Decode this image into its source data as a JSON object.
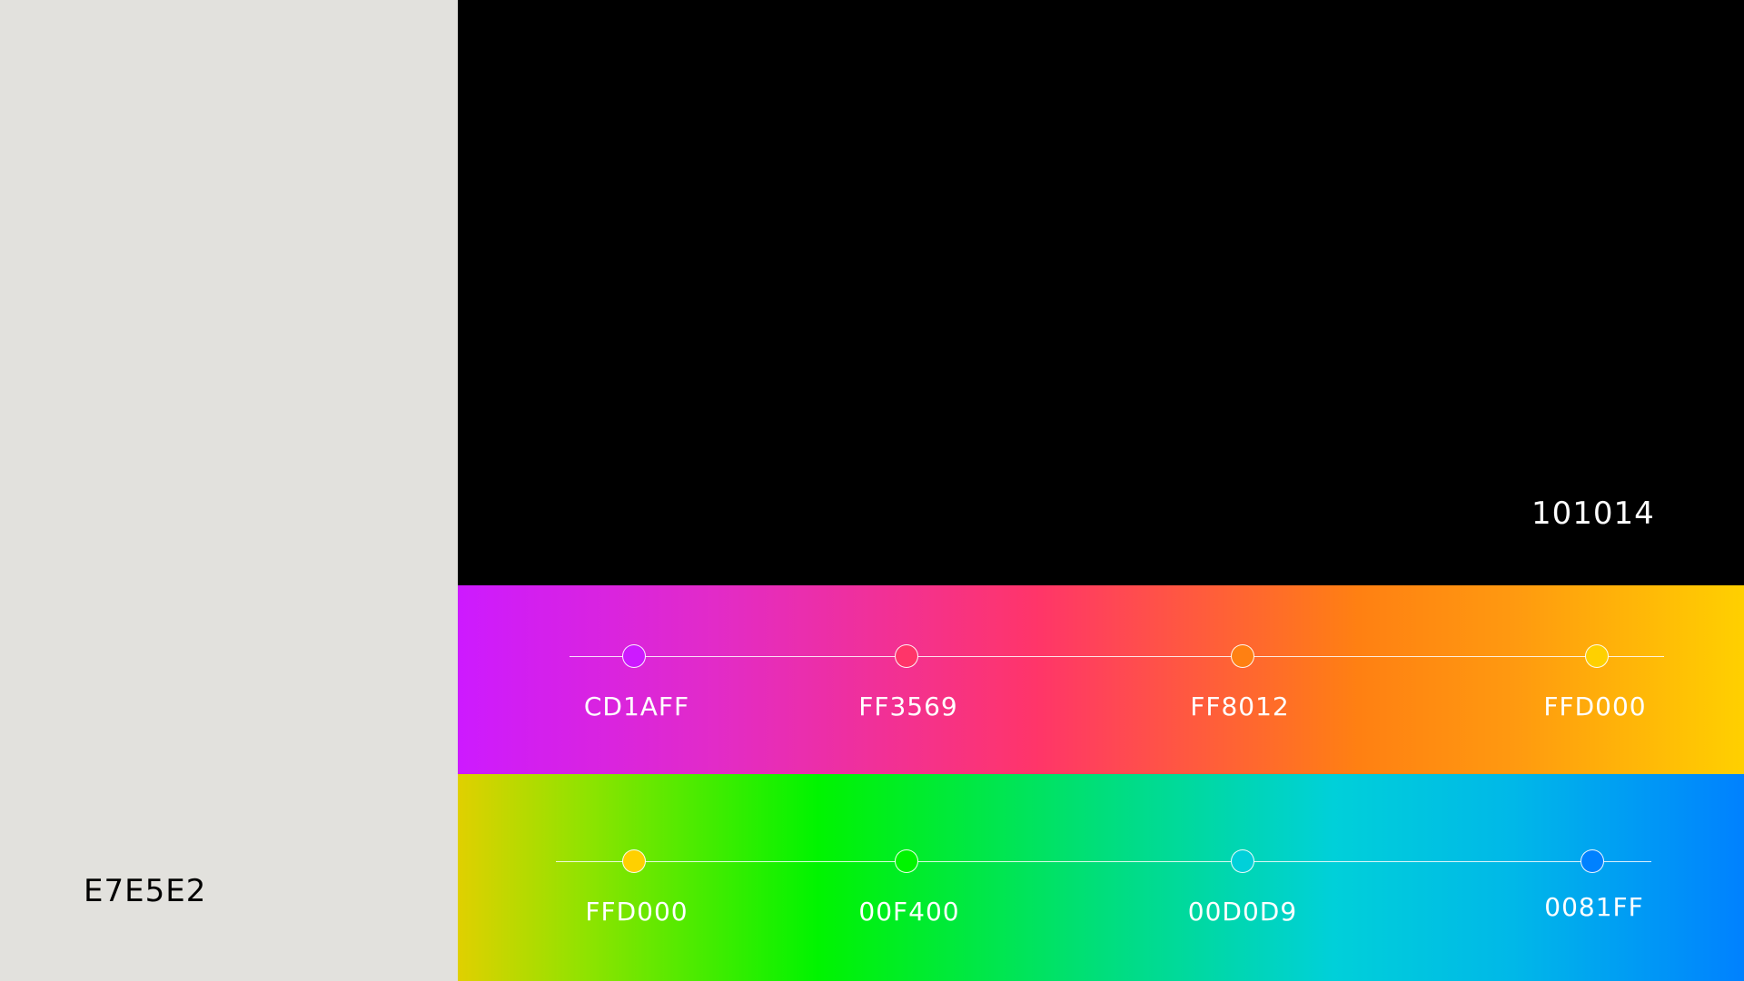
{
  "swatches": {
    "light": {
      "code": "E7E5E2",
      "color": "#E7E5E2"
    },
    "dark": {
      "code": "101014",
      "color": "#101014"
    }
  },
  "gradient_warm": {
    "stops": [
      {
        "code": "CD1AFF",
        "color": "#CD1AFF"
      },
      {
        "code": "FF3569",
        "color": "#FF3569"
      },
      {
        "code": "FF8012",
        "color": "#FF8012"
      },
      {
        "code": "FFD000",
        "color": "#FFD000"
      }
    ]
  },
  "gradient_cool": {
    "stops": [
      {
        "code": "FFD000",
        "color": "#FFD000"
      },
      {
        "code": "00F400",
        "color": "#00F400"
      },
      {
        "code": "00D0D9",
        "color": "#00D0D9"
      },
      {
        "code": "0081FF",
        "color": "#0081FF"
      }
    ]
  }
}
